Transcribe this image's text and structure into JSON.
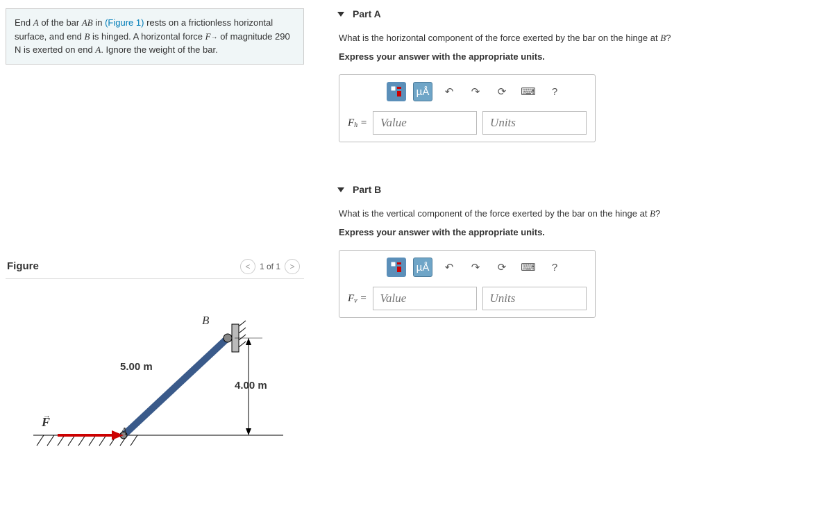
{
  "problem": {
    "text_1": "End ",
    "A": "A",
    "text_2": " of the bar ",
    "AB": "AB",
    "text_3": " in ",
    "fig_link": "(Figure 1)",
    "text_4": " rests on a frictionless horizontal surface, and end ",
    "B": "B",
    "text_5": " is hinged. A horizontal force ",
    "Fvec": "F",
    "text_6": " of magnitude 290 ",
    "N": "N",
    "text_7": " is exerted on end ",
    "text_8": ". Ignore the weight of the bar."
  },
  "figure": {
    "title": "Figure",
    "count": "1 of 1",
    "labels": {
      "B": "B",
      "A": "A",
      "len": "5.00 m",
      "height": "4.00 m",
      "Fvec": "F"
    }
  },
  "partA": {
    "title": "Part A",
    "question_1": "What is the horizontal component of the force exerted by the bar on the hinge at ",
    "B": "B",
    "question_2": "?",
    "instr": "Express your answer with the appropriate units.",
    "varname": "F",
    "sub": "h",
    "eq": " = ",
    "value_ph": "Value",
    "units_ph": "Units",
    "tool_ua": "µÅ",
    "tool_q": "?"
  },
  "partB": {
    "title": "Part B",
    "question_1": "What is the vertical component of the force exerted by the bar on the hinge at ",
    "B": "B",
    "question_2": "?",
    "instr": "Express your answer with the appropriate units.",
    "varname": "F",
    "sub": "v",
    "eq": " = ",
    "value_ph": "Value",
    "units_ph": "Units",
    "tool_ua": "µÅ",
    "tool_q": "?"
  }
}
